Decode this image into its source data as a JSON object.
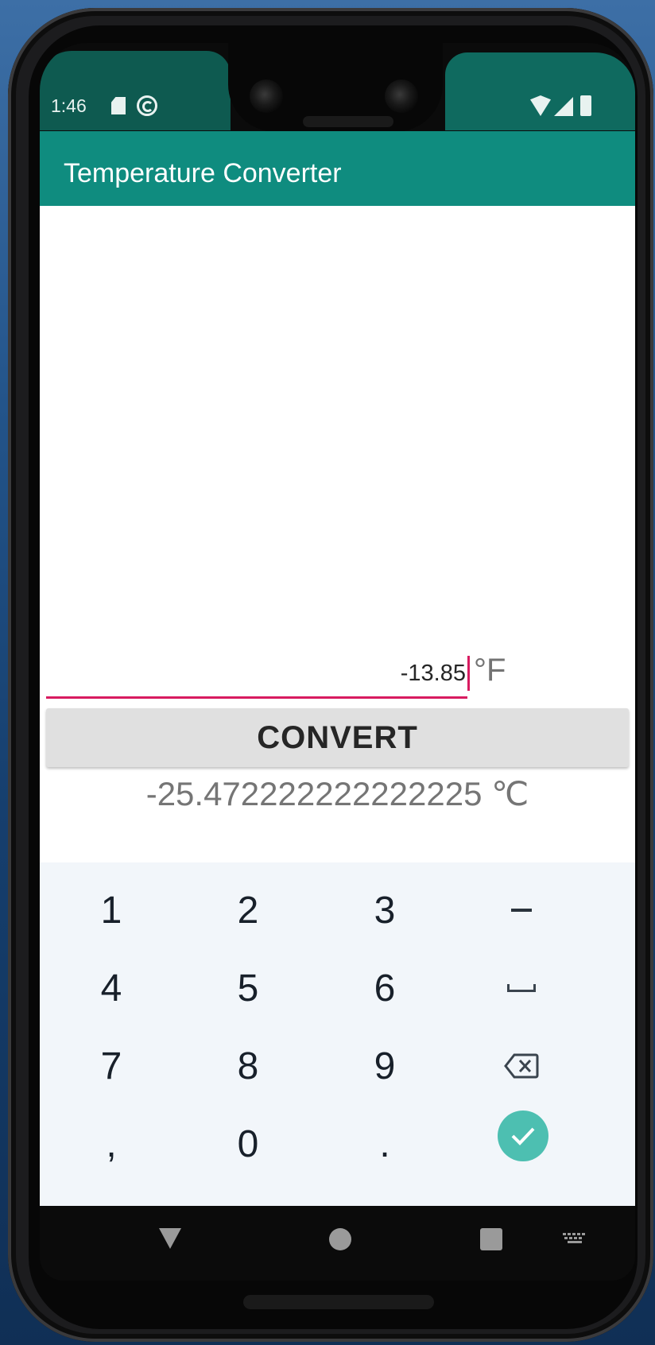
{
  "status_bar": {
    "time": "1:46",
    "icons": [
      "sd-card-icon",
      "sync-icon",
      "wifi-icon",
      "signal-icon",
      "battery-icon"
    ]
  },
  "app_bar": {
    "title": "Temperature Converter",
    "color": "#0f8c7f"
  },
  "converter": {
    "input_value": "-13.85",
    "input_unit": "°F",
    "convert_label": "CONVERT",
    "result": "-25.472222222222225 ℃",
    "accent_color": "#d81b60"
  },
  "keyboard": {
    "rows": [
      [
        "1",
        "2",
        "3",
        "–"
      ],
      [
        "4",
        "5",
        "6",
        "space"
      ],
      [
        "7",
        "8",
        "9",
        "backspace"
      ],
      [
        ",",
        "0",
        ".",
        "done"
      ]
    ],
    "labels": {
      "k1": "1",
      "k2": "2",
      "k3": "3",
      "minus": "–",
      "k4": "4",
      "k5": "5",
      "k6": "6",
      "k7": "7",
      "k8": "8",
      "k9": "9",
      "comma": ",",
      "k0": "0",
      "dot": "."
    },
    "done_color": "#4dbfb1"
  },
  "nav_bar": {
    "icons": [
      "back-icon",
      "home-icon",
      "recents-icon",
      "keyboard-switch-icon"
    ]
  }
}
